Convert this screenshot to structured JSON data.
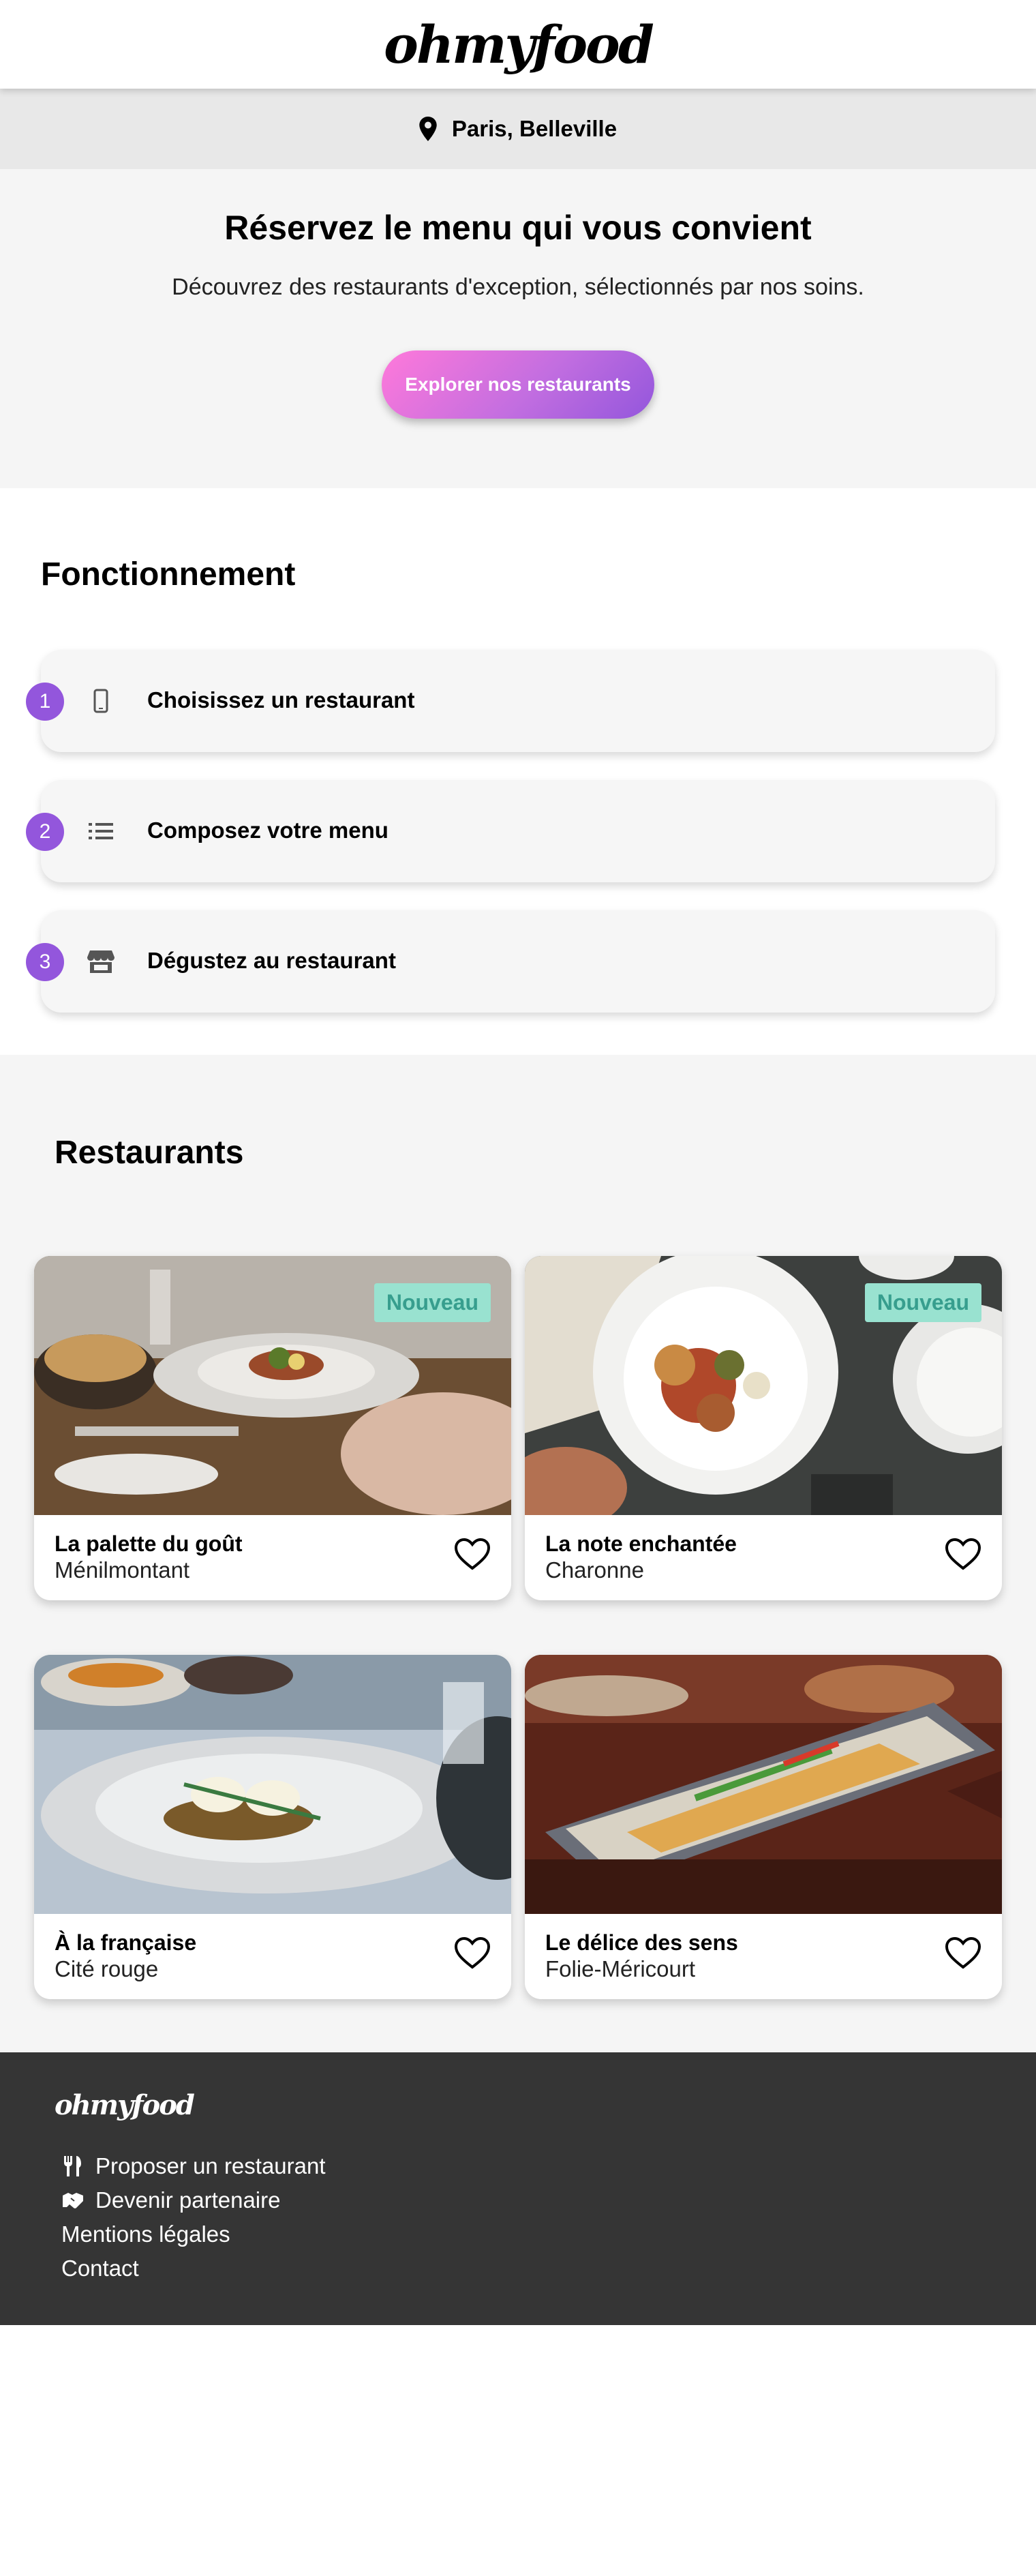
{
  "header": {
    "logo": "ohmyfood"
  },
  "location": {
    "icon": "map-pin-icon",
    "text": "Paris, Belleville"
  },
  "hero": {
    "title": "Réservez le menu qui vous convient",
    "subtitle": "Découvrez des restaurants d'exception, sélectionnés par nos soins.",
    "cta_label": "Explorer nos restaurants"
  },
  "how": {
    "title": "Fonctionnement",
    "steps": [
      {
        "number": "1",
        "icon": "mobile-phone-icon",
        "label": "Choisissez un restaurant"
      },
      {
        "number": "2",
        "icon": "list-icon",
        "label": "Composez votre menu"
      },
      {
        "number": "3",
        "icon": "store-icon",
        "label": "Dégustez au restaurant"
      }
    ]
  },
  "restaurants": {
    "title": "Restaurants",
    "items": [
      {
        "name": "La palette du goût",
        "area": "Ménilmontant",
        "badge": "Nouveau"
      },
      {
        "name": "La note enchantée",
        "area": "Charonne",
        "badge": "Nouveau"
      },
      {
        "name": "À la française",
        "area": "Cité rouge",
        "badge": ""
      },
      {
        "name": "Le délice des sens",
        "area": "Folie-Méricourt",
        "badge": ""
      }
    ]
  },
  "footer": {
    "logo": "ohmyfood",
    "links": [
      {
        "icon": "utensils-icon",
        "label": "Proposer un restaurant"
      },
      {
        "icon": "handshake-icon",
        "label": "Devenir partenaire"
      },
      {
        "icon": "",
        "label": "Mentions légales"
      },
      {
        "icon": "",
        "label": "Contact"
      }
    ]
  },
  "colors": {
    "accent": "#9356dc",
    "cta_start": "#ff79da",
    "badge_bg": "#99e2d0",
    "badge_text": "#379e8e",
    "footer_bg": "#353535"
  }
}
